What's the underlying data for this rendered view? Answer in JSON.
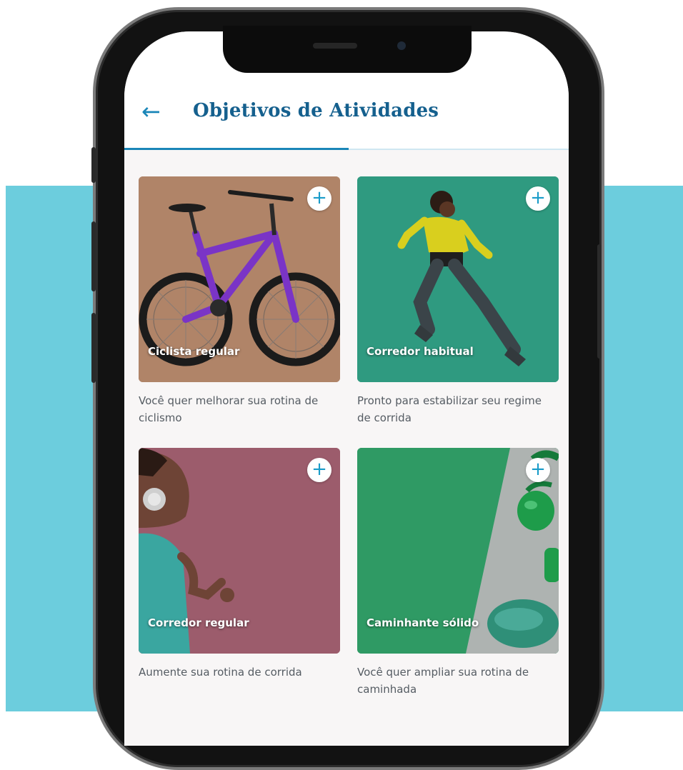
{
  "header": {
    "back_label": "←",
    "title": "Objetivos de Atividades"
  },
  "cards": [
    {
      "label": "Ciclista regular",
      "description": "Você quer melhorar sua rotina de ciclismo",
      "add_label": "+",
      "color": "#b08468"
    },
    {
      "label": "Corredor habitual",
      "description": "Pronto para estabilizar seu regime de corrida",
      "add_label": "+",
      "color": "#2f9a80"
    },
    {
      "label": "Corredor regular",
      "description": "Aumente sua rotina de corrida",
      "add_label": "+",
      "color": "#9c5c6c"
    },
    {
      "label": "Caminhante sólido",
      "description": "Você quer ampliar sua rotina de caminhada",
      "add_label": "+",
      "color": "#2f9a64"
    }
  ],
  "colors": {
    "background": "#6ccddd",
    "accent": "#1a86b8",
    "title": "#15608e",
    "screen": "#f8f6f6"
  },
  "icons": [
    "back-arrow-icon",
    "plus-icon",
    "bicycle-illustration",
    "runner-illustration",
    "headphones-runner-illustration",
    "green-apples-illustration"
  ]
}
